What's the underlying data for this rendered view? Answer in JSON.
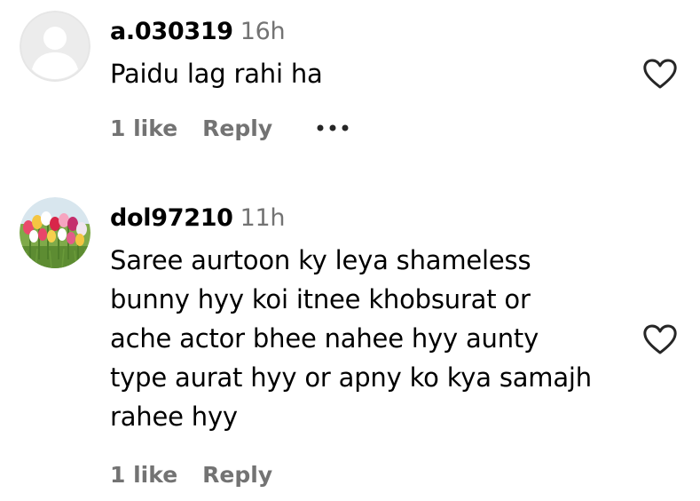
{
  "comments": [
    {
      "username": "a.030319",
      "time": "16h",
      "text": "Paidu lag rahi ha",
      "likes": "1 like",
      "reply": "Reply",
      "avatar": "default-avatar"
    },
    {
      "username": "dol97210",
      "time": "11h",
      "text": "Saree aurtoon ky leya shameless\nbunny hyy koi itnee khobsurat or\nache actor bhee nahee hyy aunty\ntype aurat hyy or apny ko kya samajh\nrahee hyy",
      "likes": "1 like",
      "reply": "Reply",
      "avatar": "tulip-flowers-photo"
    }
  ],
  "icons": {
    "like": "heart-outline-icon",
    "more": "more-options-icon"
  },
  "colors": {
    "text": "#000000",
    "secondary": "#737373",
    "avatar_placeholder": "#dbdbdb"
  }
}
